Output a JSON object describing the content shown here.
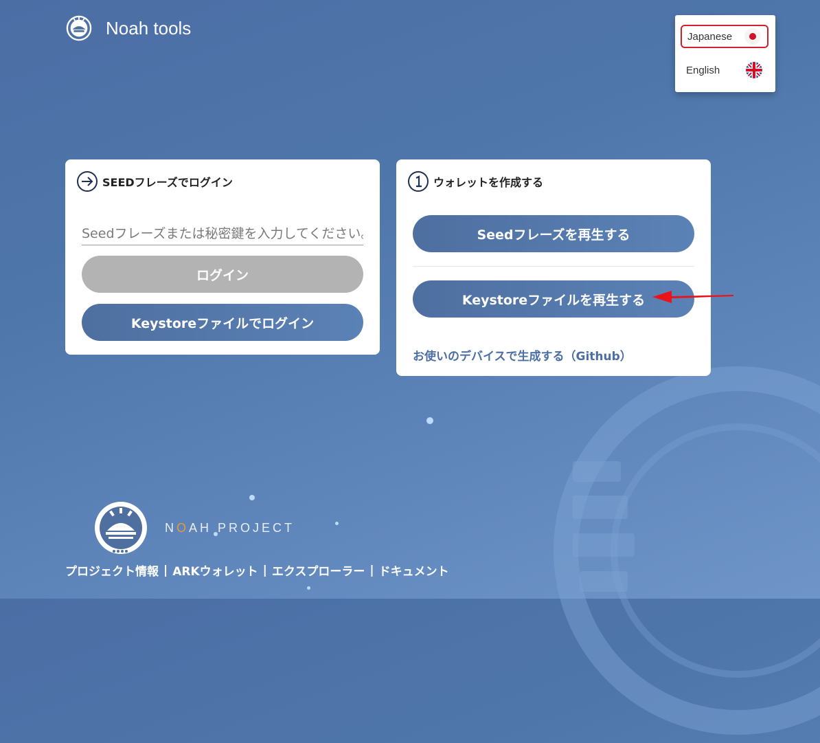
{
  "header": {
    "title": "Noah tools"
  },
  "language_menu": {
    "items": [
      {
        "label": "Japanese",
        "flag": "japan-flag-icon",
        "selected": true
      },
      {
        "label": "English",
        "flag": "uk-flag-icon",
        "selected": false
      }
    ]
  },
  "login_card": {
    "title": "SEEDフレーズでログイン",
    "icon": "login-arrow-icon",
    "seed_placeholder": "Seedフレーズまたは秘密鍵を入力してください。",
    "login_label": "ログイン",
    "keystore_login_label": "Keystoreファイルでログイン"
  },
  "create_card": {
    "title": "ウォレットを作成する",
    "icon": "step-one-icon",
    "regenerate_seed_label": "Seedフレーズを再生する",
    "regenerate_keystore_label": "Keystoreファイルを再生する",
    "github_link": "お使いのデバイスで生成する（Github）"
  },
  "footer": {
    "project_prefix": "N",
    "project_o": "O",
    "project_suffix": "AH PROJECT",
    "links": [
      "プロジェクト情報",
      "ARKウォレット",
      "エクスプローラー",
      "ドキュメント"
    ],
    "separator": "|"
  },
  "colors": {
    "accent": "#4e6fa0",
    "disabled": "#b3b3b3",
    "annotation_arrow": "#e8141a"
  }
}
